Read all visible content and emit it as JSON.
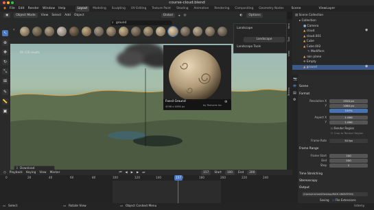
{
  "window": {
    "title": "course-cloud.blend"
  },
  "menu": {
    "items": [
      "File",
      "Edit",
      "Render",
      "Window",
      "Help"
    ],
    "workspaces": [
      "Layout",
      "Modeling",
      "Sculpting",
      "UV Editing",
      "Texture Paint",
      "Shading",
      "Animation",
      "Rendering",
      "Compositing",
      "Geometry Nodes"
    ],
    "active_workspace": "Layout",
    "scene": "Scene",
    "view_layer": "ViewLayer"
  },
  "viewport_header": {
    "mode": "Object Mode",
    "menus": [
      "View",
      "Select",
      "Add",
      "Object"
    ],
    "transform": "Global",
    "options": "Options"
  },
  "asset_browser": {
    "search": "ground",
    "popover": {
      "title": "Landscape",
      "button": "Landscape",
      "section": "Landscape Tools"
    }
  },
  "viewport_overlay": {
    "text": "Fill 116 results"
  },
  "preview": {
    "name": "Fossil Ground",
    "author": "by Textures Inc",
    "size": "4096 x 4096 px"
  },
  "download": {
    "label": "Download"
  },
  "n_panel_tabs": [
    "Item",
    "Tool",
    "View",
    "Terrain"
  ],
  "outliner": {
    "rows": [
      {
        "label": "Scene Collection",
        "indent": 0
      },
      {
        "label": "Collection",
        "indent": 1
      },
      {
        "label": "Camera",
        "indent": 2
      },
      {
        "label": "cloud",
        "indent": 2
      },
      {
        "label": "cloud.001",
        "indent": 2
      },
      {
        "label": "Cube",
        "indent": 2
      },
      {
        "label": "Cube.002",
        "indent": 2
      },
      {
        "label": "Modifiers",
        "indent": 3
      },
      {
        "label": "rain plane",
        "indent": 2
      },
      {
        "label": "Empty",
        "indent": 2
      },
      {
        "label": "ground",
        "indent": 2,
        "selected": true
      }
    ]
  },
  "properties": {
    "scene_name": "Scene",
    "format_section": "Format",
    "resolution_x_label": "Resolution X",
    "resolution_x": "1920 px",
    "resolution_y_label": "Y",
    "resolution_y": "1080 px",
    "percent": "100%",
    "aspect_x_label": "Aspect X",
    "aspect_x": "1.000",
    "aspect_y_label": "Y",
    "aspect_y": "1.000",
    "render_region": "Render Region",
    "crop": "Crop to Render Region",
    "frame_rate_label": "Frame Rate",
    "frame_rate": "30 fps",
    "frame_range_section": "Frame Range",
    "frame_start_label": "Frame Start",
    "frame_start": "100",
    "end_label": "End",
    "end": "200",
    "step_label": "Step",
    "step": "1",
    "time_stretching": "Time Stretching",
    "stereoscopy": "Stereoscopy",
    "output_section": "Output",
    "output_path": "/Users/michael/Desktop/RAIN ANIMATION/",
    "saving_label": "Saving",
    "file_ext": "File Extensions"
  },
  "timeline": {
    "menus": [
      "Playback",
      "Keying",
      "View",
      "Marker"
    ],
    "current_frame": "157",
    "start_label": "Start",
    "start": "100",
    "end_label": "End",
    "end": "200",
    "ticks": [
      "0",
      "20",
      "40",
      "60",
      "80",
      "100",
      "120",
      "140",
      "160",
      "180",
      "200",
      "220",
      "240"
    ]
  },
  "statusbar": {
    "select": "Select",
    "rotate": "Rotate View",
    "context": "Object Context Menu",
    "version": "Udemy"
  },
  "colors": {
    "accent": "#4772b3",
    "selected_row": "#3b5a8a",
    "timeline_marker": "#4a78c2"
  }
}
